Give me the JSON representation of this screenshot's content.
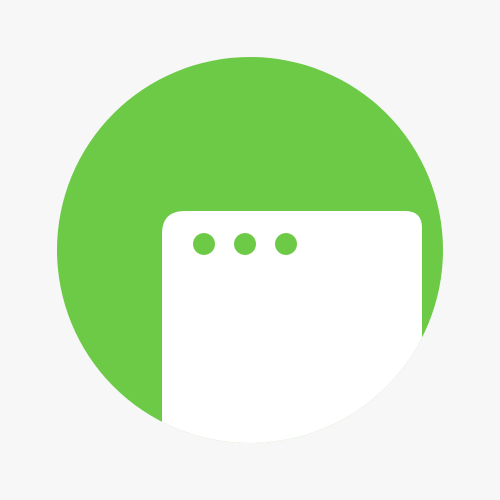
{
  "icon": {
    "name": "browser-window-icon",
    "background_color": "#f7f7f7",
    "circle_color": "#6cca47",
    "window_color": "#ffffff",
    "dot_color": "#6cca47",
    "dot_count": 3
  }
}
